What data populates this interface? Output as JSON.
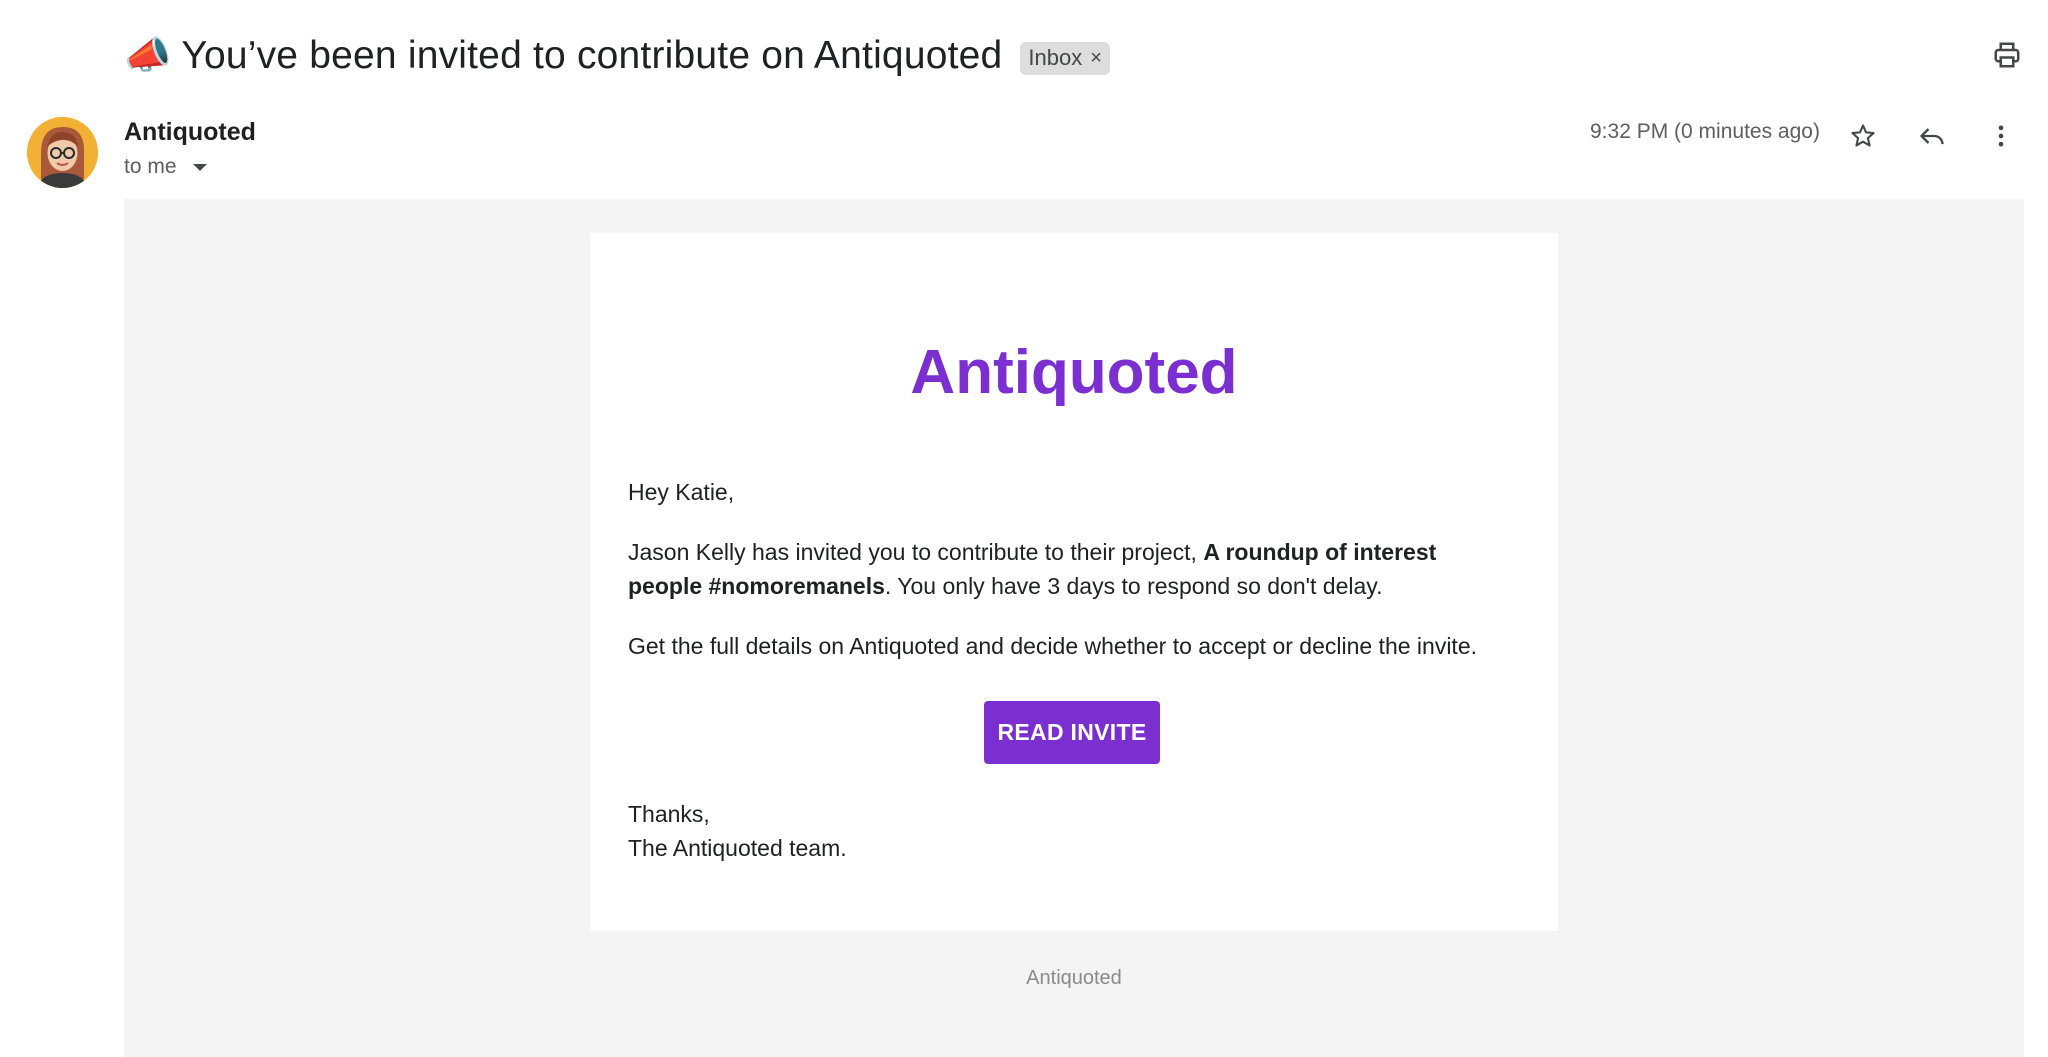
{
  "header": {
    "subject_emoji": "📣",
    "subject": "You’ve been invited to contribute on Antiquoted",
    "label": "Inbox",
    "label_remove": "×"
  },
  "message": {
    "sender": "Antiquoted",
    "recipient": "to me",
    "timestamp": "9:32 PM (0 minutes ago)"
  },
  "icons": {
    "print": "printer-icon",
    "star": "star-icon",
    "reply": "reply-icon",
    "more": "more-vert-icon",
    "caret": "caret-down-icon"
  },
  "email": {
    "brand": "Antiquoted",
    "greeting": "Hey Katie,",
    "para1_start": "Jason Kelly has invited you to contribute to their project, ",
    "para1_bold": "A roundup of interest people #nomoremanels",
    "para1_end": ". You only have 3 days to respond so don't delay.",
    "para2": "Get the full details on Antiquoted and decide whether to accept or decline the invite.",
    "cta": "READ INVITE",
    "signoff1": "Thanks,",
    "signoff2": "The Antiquoted team.",
    "footer": "Antiquoted"
  },
  "colors": {
    "brand": "#7b2fd0",
    "body_background": "#f4f4f4",
    "chip": "#dddddd"
  }
}
